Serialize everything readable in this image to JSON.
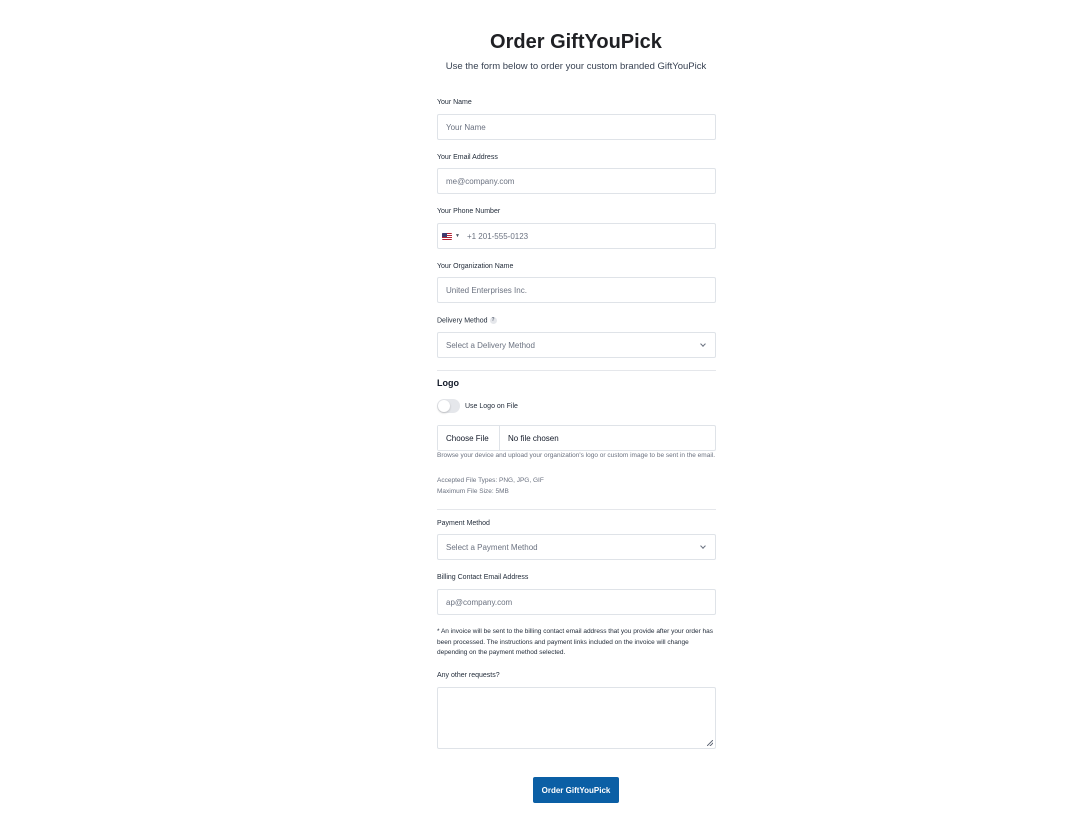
{
  "header": {
    "title": "Order GiftYouPick",
    "subtitle": "Use the form below to order your custom branded GiftYouPick"
  },
  "form": {
    "name": {
      "label": "Your Name",
      "placeholder": "Your Name"
    },
    "email": {
      "label": "Your Email Address",
      "placeholder": "me@company.com"
    },
    "phone": {
      "label": "Your Phone Number",
      "placeholder": "+1 201-555-0123",
      "country_flag_icon": "us-flag-icon"
    },
    "organization": {
      "label": "Your Organization Name",
      "placeholder": "United Enterprises Inc."
    },
    "delivery": {
      "label": "Delivery Method",
      "help": "?",
      "selected": "Select a Delivery Method"
    },
    "logo": {
      "section_title": "Logo",
      "toggle_label": "Use Logo on File",
      "toggle_on": false,
      "file_button": "Choose File",
      "file_status": "No file chosen",
      "hint": "Browse your device and upload your organization's logo or custom image to be sent in the email.",
      "accepted_types": "Accepted File Types: PNG, JPG, GIF",
      "max_size": "Maximum File Size: 5MB"
    },
    "payment": {
      "label": "Payment Method",
      "selected": "Select a Payment Method"
    },
    "billing_email": {
      "label": "Billing Contact Email Address",
      "placeholder": "ap@company.com"
    },
    "invoice_note": "* An invoice will be sent to the billing contact email address that you provide after your order has been processed. The instructions and payment links included on the invoice will change depending on the payment method selected.",
    "requests": {
      "label": "Any other requests?"
    },
    "submit_label": "Order GiftYouPick"
  },
  "colors": {
    "accent": "#0b5fa5",
    "border": "#dfe3e8",
    "muted_text": "#6b7280"
  }
}
